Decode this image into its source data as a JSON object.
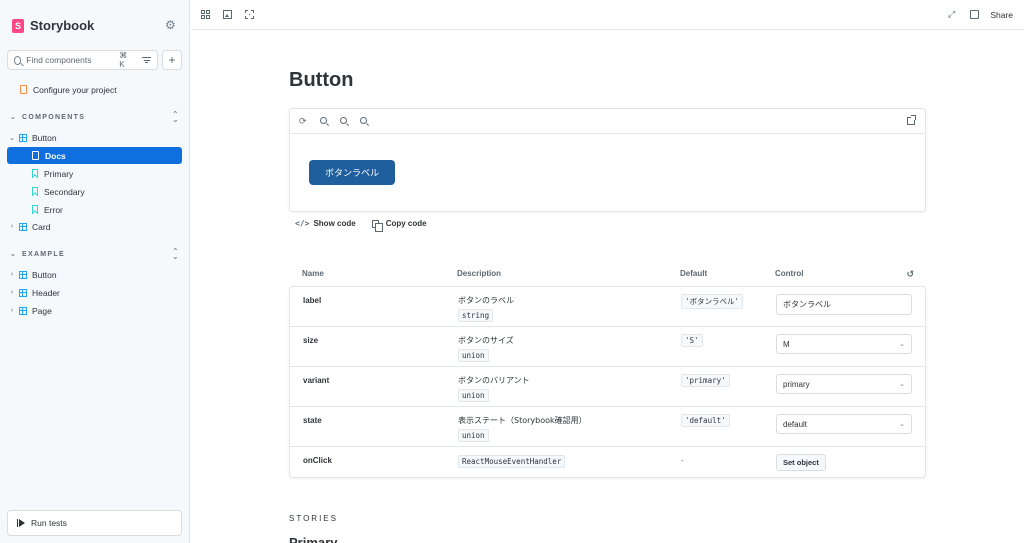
{
  "brand": {
    "name": "Storybook"
  },
  "search": {
    "placeholder": "Find components",
    "shortcut": "⌘ K"
  },
  "sidebar": {
    "configure": "Configure your project",
    "sections": [
      {
        "label": "COMPONENTS"
      },
      {
        "label": "EXAMPLE"
      }
    ],
    "components": {
      "button": "Button",
      "docs": "Docs",
      "primary": "Primary",
      "secondary": "Secondary",
      "error": "Error",
      "card": "Card"
    },
    "example": {
      "button": "Button",
      "header": "Header",
      "page": "Page"
    },
    "run_tests": "Run tests"
  },
  "toolbar": {
    "share": "Share"
  },
  "main": {
    "title": "Button",
    "demo_button": "ボタンラベル",
    "show_code": "Show code",
    "copy_code": "Copy code",
    "stories": "STORIES",
    "primary_heading": "Primary"
  },
  "args": {
    "columns": {
      "name": "Name",
      "description": "Description",
      "default": "Default",
      "control": "Control"
    },
    "rows": [
      {
        "name": "label",
        "desc": "ボタンのラベル",
        "type": "string",
        "default": "'ボタンラベル'",
        "control_value": "ボタンラベル"
      },
      {
        "name": "size",
        "desc": "ボタンのサイズ",
        "type": "union",
        "default": "'S'",
        "control_value": "M"
      },
      {
        "name": "variant",
        "desc": "ボタンのバリアント",
        "type": "union",
        "default": "'primary'",
        "control_value": "primary"
      },
      {
        "name": "state",
        "desc": "表示ステート（Storybook確認用）",
        "type": "union",
        "default": "'default'",
        "control_value": "default"
      },
      {
        "name": "onClick",
        "type": "ReactMouseEventHandler",
        "default": "-",
        "control_value": "Set object"
      }
    ]
  },
  "colors": {
    "accent": "#0f6fde",
    "brand": "#ff4785",
    "demo_button": "#1f5f9e"
  }
}
